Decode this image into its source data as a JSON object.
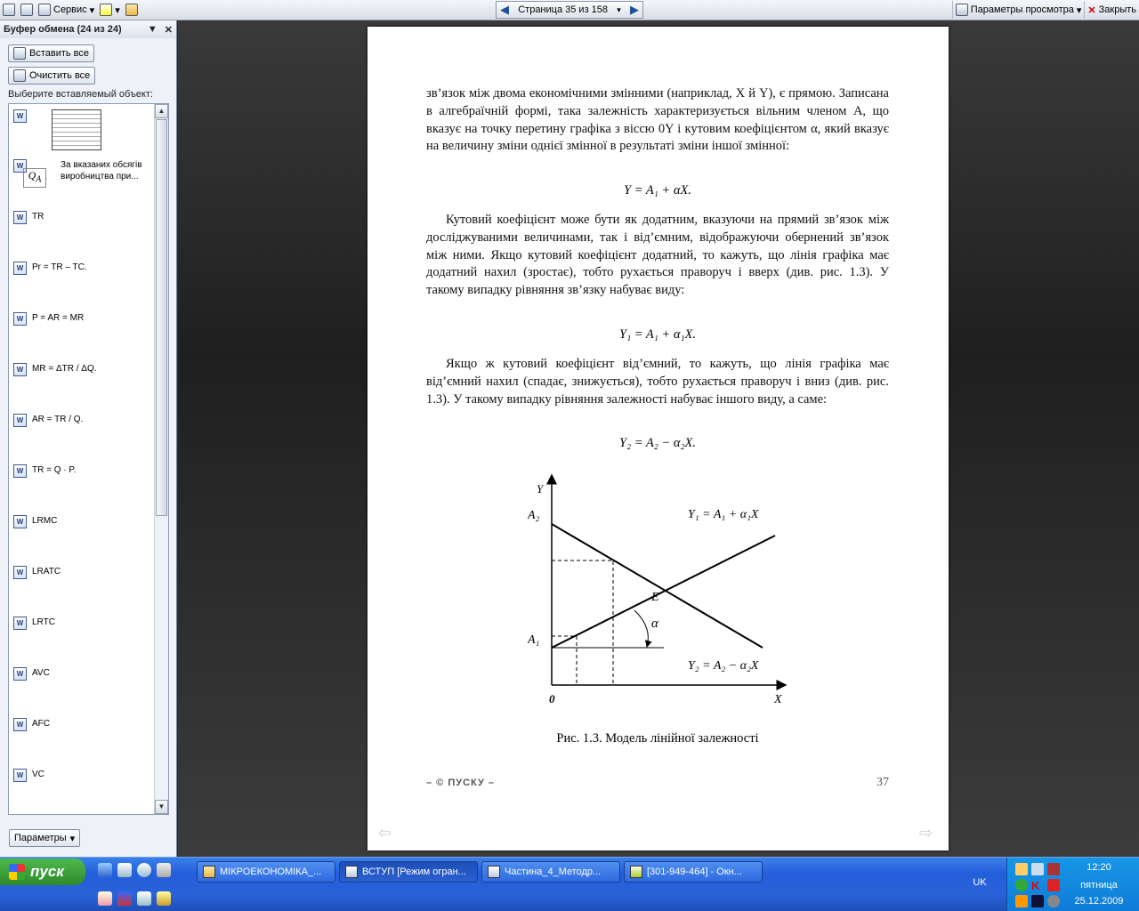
{
  "toolbar": {
    "service": "Сервис",
    "page": "Страница 35 из 158",
    "view_options": "Параметры просмотра",
    "close": "Закрыть"
  },
  "clipboard": {
    "title": "Буфер обмена (24 из 24)",
    "paste_all": "Вставить все",
    "clear_all": "Очистить все",
    "select_label": "Выберите вставляемый объект:",
    "options": "Параметры",
    "items": [
      "За вказаних обсягів виробництва при...",
      "TR",
      "Pr = TR – TC.",
      "P = AR = MR",
      "MR = ΔTR / ΔQ.",
      "AR = TR / Q.",
      "TR = Q · P.",
      "LRMC",
      "LRATC",
      "LRTC",
      "AVC",
      "AFC",
      "VC"
    ],
    "qa_icon_text": "Q_A"
  },
  "page": {
    "para1": "зв’язок між двома економічними змінними (наприклад, X й Y), є прямою. Записана в алгебраїчній формі, така залежність характеризується вільним членом A, що вказує на точку перетину графіка з віссю 0Y і кутовим коефіцієнтом α, який вказує на величину зміни однієї змінної в результаті зміни іншої змінної:",
    "formula1": "Y = A₁ + αX.",
    "para2": "Кутовий коефіцієнт може бути як додатним, вказуючи на прямий зв’язок між досліджуваними величинами, так і від’ємним, відображуючи обернений зв’язок між ними. Якщо кутовий коефіцієнт додатний, то кажуть, що лінія графіка має додатний нахил (зростає), тобто рухається праворуч і вверх (див. рис. 1.3). У такому випадку рівняння зв’язку набуває виду:",
    "formula2": "Y₁ = A₁ + α₁X.",
    "para3": "Якщо ж кутовий коефіцієнт від’ємний, то кажуть, що лінія графіка має від’ємний нахил (спадає, знижується), тобто рухається праворуч і вниз (див. рис. 1.3). У такому випадку рівняння залежності набуває іншого виду, а саме:",
    "formula3": "Y₂ = A₂ − α₂X.",
    "fig": {
      "y": "Y",
      "x": "X",
      "origin": "0",
      "a2": "A₂",
      "a1": "A₁",
      "e": "E",
      "alpha": "α",
      "line1": "Y₁ = A₁ + α₁X",
      "line2": "Y₂ = A₂ − α₂X"
    },
    "caption": "Рис. 1.3. Модель лінійної залежності",
    "footer_left": "– © ПУСКУ –",
    "page_number": "37"
  },
  "taskbar": {
    "start": "пуск",
    "lang": "UK",
    "time": "12:20",
    "day": "пятница",
    "date": "25.12.2009",
    "tasks": [
      "МІКРОЕКОНОМІКА_...",
      "ВСТУП [Режим огран...",
      "Частина_4_Методр...",
      "[301-949-464] - Окн..."
    ]
  }
}
